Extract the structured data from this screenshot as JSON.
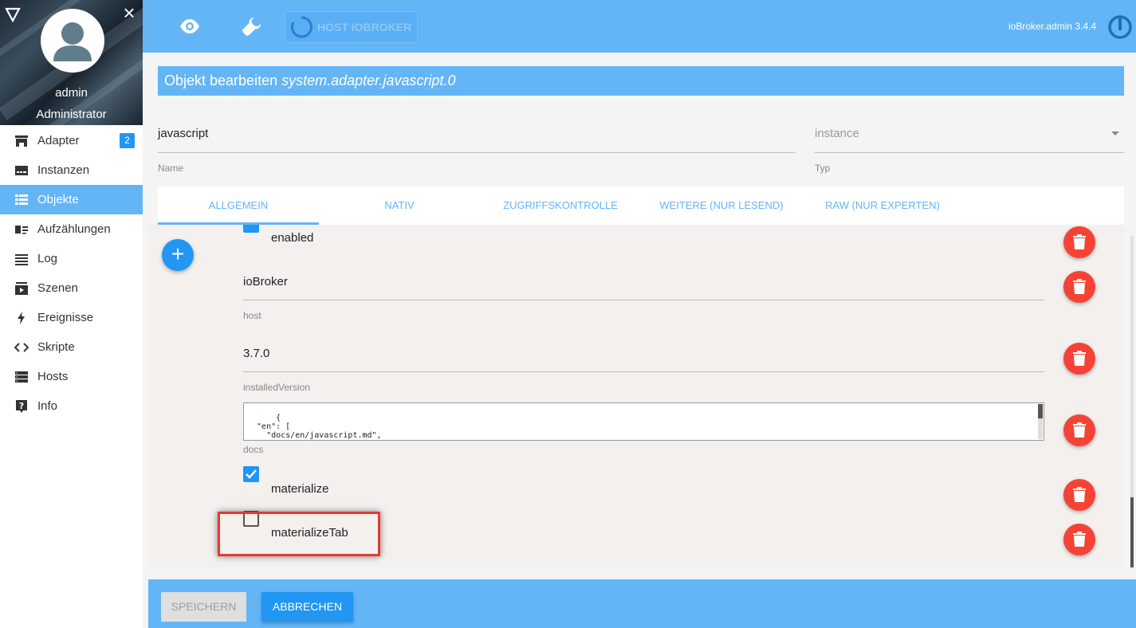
{
  "sidebar": {
    "user_name": "admin",
    "user_role": "Administrator",
    "items": [
      {
        "label": "Adapter",
        "icon": "store-icon",
        "badge": "2"
      },
      {
        "label": "Instanzen",
        "icon": "instances-icon"
      },
      {
        "label": "Objekte",
        "icon": "table-icon",
        "active": true
      },
      {
        "label": "Aufzählungen",
        "icon": "enum-icon"
      },
      {
        "label": "Log",
        "icon": "list-icon"
      },
      {
        "label": "Szenen",
        "icon": "scenes-icon"
      },
      {
        "label": "Ereignisse",
        "icon": "bolt-icon"
      },
      {
        "label": "Skripte",
        "icon": "code-icon"
      },
      {
        "label": "Hosts",
        "icon": "hosts-icon"
      },
      {
        "label": "Info",
        "icon": "help-icon"
      }
    ]
  },
  "topbar": {
    "host_button": "HOST IOBROKER",
    "version": "ioBroker.admin 3.4.4"
  },
  "dialog": {
    "title_prefix": "Objekt bearbeiten",
    "title_object": "system.adapter.javascript.0",
    "name_value": "javascript",
    "name_label": "Name",
    "type_value": "instance",
    "type_label": "Typ",
    "tabs": [
      "ALLGEMEIN",
      "NATIV",
      "ZUGRIFFSKONTROLLE",
      "WEITERE (NUR LESEND)",
      "RAW (NUR EXPERTEN)"
    ],
    "fields": {
      "enabled_label": "enabled",
      "host_value": "ioBroker",
      "host_label": "host",
      "installed_version_value": "3.7.0",
      "installed_version_label": "installedVersion",
      "docs_value": "{\n  \"en\": [\n    \"docs/en/javascript.md\",\n    \"docs/en/blockly.md\"",
      "docs_label": "docs",
      "materialize_label": "materialize",
      "materialize_tab_label": "materializeTab"
    },
    "save_label": "SPEICHERN",
    "cancel_label": "ABBRECHEN"
  },
  "colors": {
    "primary": "#64b5f6",
    "accent": "#2196f3",
    "delete": "#f44336",
    "highlight": "#e53935"
  }
}
